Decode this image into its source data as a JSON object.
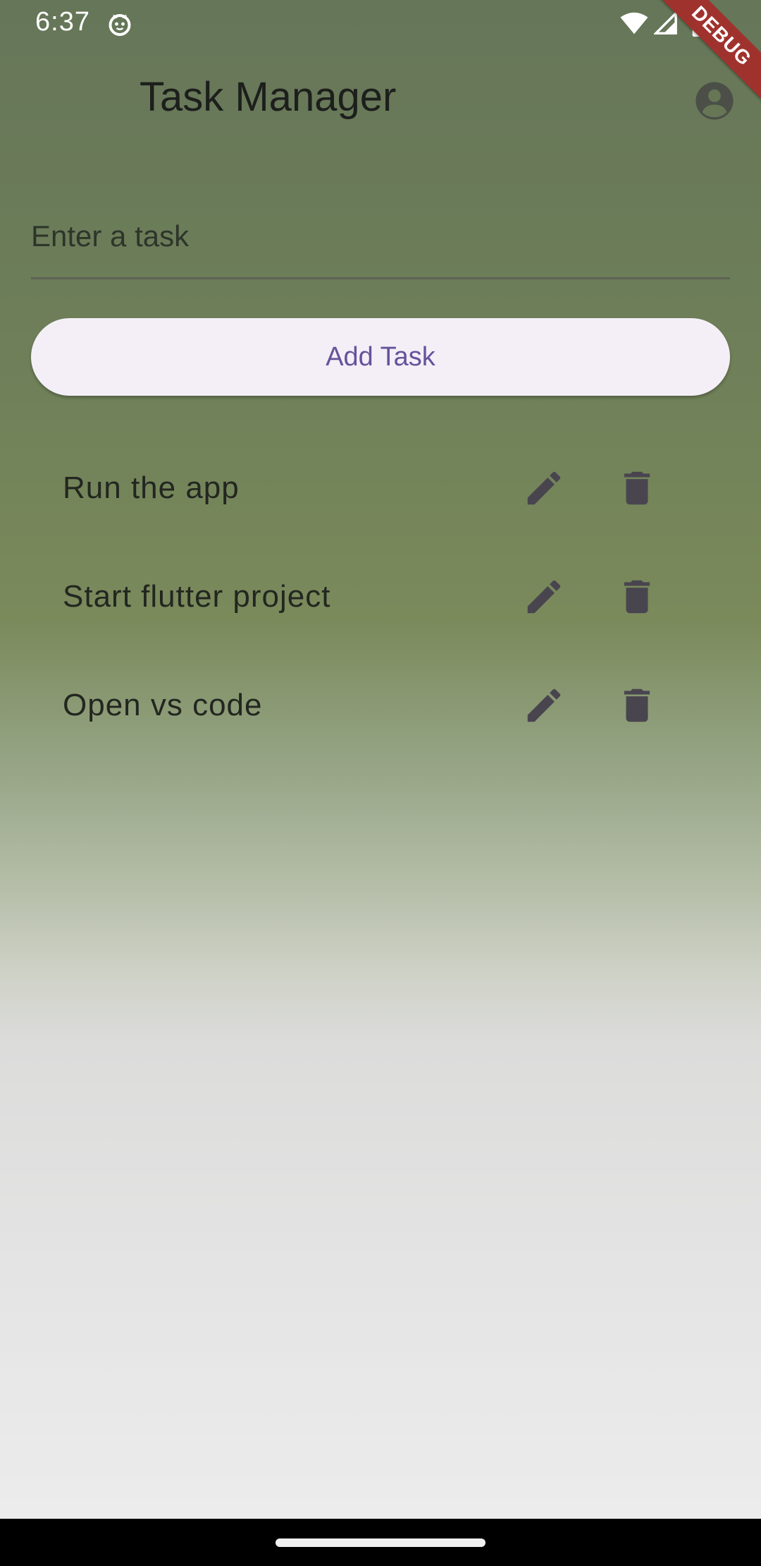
{
  "status_bar": {
    "time": "6:37",
    "icons": [
      "cat-notification-icon",
      "wifi-icon",
      "signal-icon",
      "battery-icon"
    ]
  },
  "debug_banner": {
    "label": "DEBUG"
  },
  "app_bar": {
    "title": "Task Manager",
    "profile_icon": "account-circle-icon"
  },
  "task_input": {
    "placeholder": "Enter a task",
    "value": ""
  },
  "add_button": {
    "label": "Add Task"
  },
  "tasks": [
    {
      "label": "Run the app",
      "edit_icon": "pencil-icon",
      "delete_icon": "trash-icon"
    },
    {
      "label": "Start flutter project",
      "edit_icon": "pencil-icon",
      "delete_icon": "trash-icon"
    },
    {
      "label": "Open vs code",
      "edit_icon": "pencil-icon",
      "delete_icon": "trash-icon"
    }
  ],
  "colors": {
    "accent": "#66529b",
    "button_bg": "#f4eff7",
    "icon": "#49454f",
    "debug_banner": "#a0322e"
  }
}
